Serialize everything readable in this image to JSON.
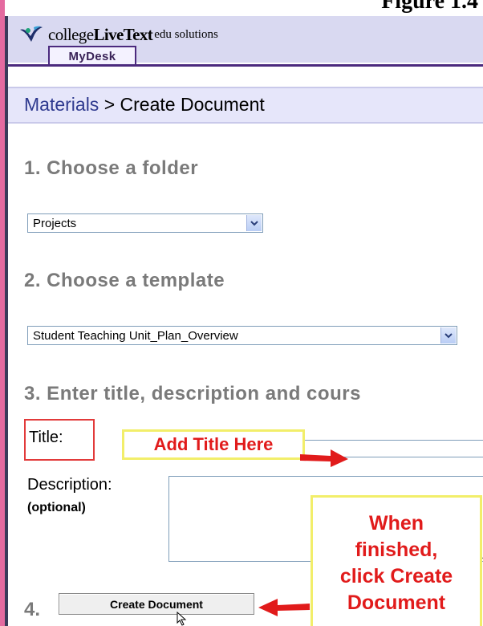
{
  "figure_caption": "Figure 1.4",
  "brand": {
    "name_light": "college",
    "name_bold": "LiveText",
    "tag": "edu solutions"
  },
  "nav": {
    "tab_label": "MyDesk"
  },
  "breadcrumb": {
    "parent": "Materials",
    "separator": ">",
    "current": "Create Document"
  },
  "steps": {
    "folder_heading": "1. Choose a folder",
    "folder_selected": "Projects",
    "template_heading": "2. Choose a template",
    "template_selected": "Student Teaching Unit_Plan_Overview",
    "details_heading": "3. Enter title, description and cours"
  },
  "form": {
    "title_label": "Title:",
    "title_value": "",
    "description_label": "Description:",
    "optional_label": "(optional)",
    "description_value": "",
    "step4_number": "4.",
    "create_button_label": "Create Document"
  },
  "annotations": {
    "title_note": "Add Title Here",
    "finish_note": "When\nfinished,\nclick Create\nDocument"
  },
  "colors": {
    "annotation_red": "#e11b1b",
    "annotation_border": "#f2ee6a",
    "tab_border": "#4b2a7e"
  },
  "icons": {
    "logo": "bird-logo-icon",
    "dropdown": "chevron-down-icon",
    "cursor": "mouse-pointer-icon"
  }
}
